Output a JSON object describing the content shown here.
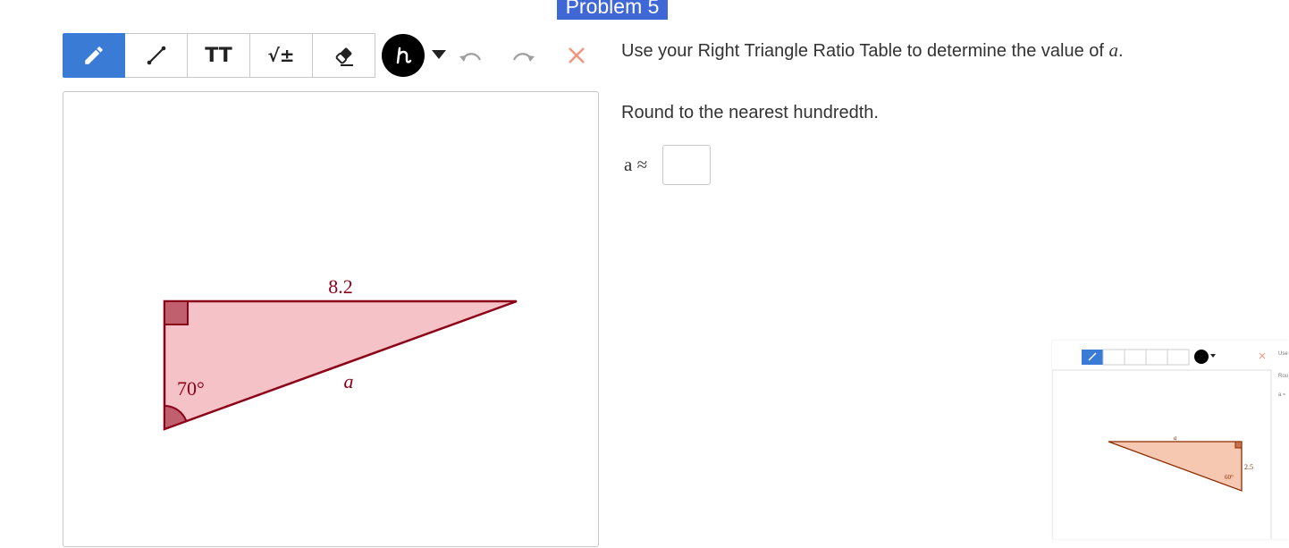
{
  "header": {
    "title": "Problem 5"
  },
  "toolbar": {
    "tools": [
      {
        "name": "pencil-icon",
        "active": true
      },
      {
        "name": "line-icon"
      },
      {
        "name": "text-icon",
        "label": "TT"
      },
      {
        "name": "math-icon",
        "label": "√±"
      },
      {
        "name": "eraser-icon"
      }
    ],
    "color": "#000000",
    "accent": "#3a7bd5"
  },
  "problem": {
    "prompt_text": "Use your Right Triangle Ratio Table to determine the value of",
    "variable": "a",
    "period": ".",
    "instruction": "Round to the nearest hundredth.",
    "answer_label": "a ≈",
    "answer_value": ""
  },
  "figure": {
    "side_label": "8.2",
    "angle_label": "70°",
    "hyp_label": "a",
    "fill_color": "#f4c2c7",
    "stroke_color": "#8b0018"
  },
  "thumbnail": {
    "side_label": "2.5",
    "angle_label": "60°",
    "hyp_label": "a",
    "text_1": "Use",
    "text_2": "Rou",
    "text_3": "a ≈"
  }
}
